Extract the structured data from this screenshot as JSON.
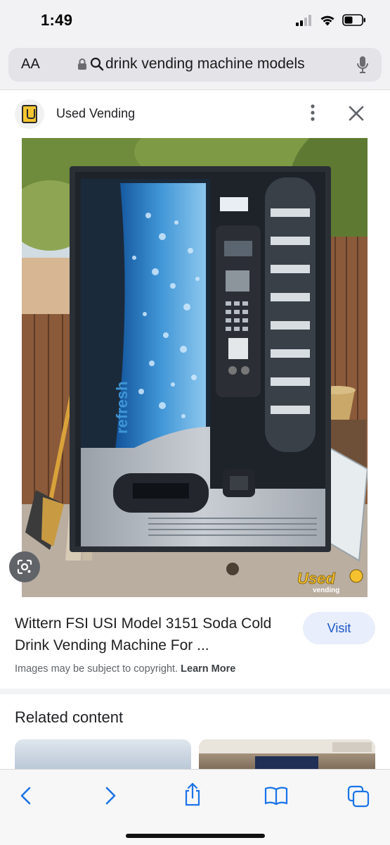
{
  "status": {
    "time": "1:49"
  },
  "browser": {
    "text_size_label": "AA",
    "url": "drink vending machine models"
  },
  "source": {
    "name": "Used Vending"
  },
  "image": {
    "machine_brand_text": "refresh",
    "watermark_text": "Used",
    "watermark_sub": "vending"
  },
  "result": {
    "title": "Wittern FSI USI Model 3151 Soda Cold Drink Vending Machine For ...",
    "visit_label": "Visit",
    "copyright_text": "Images may be subject to copyright.",
    "learn_more_label": "Learn More"
  },
  "related": {
    "heading": "Related content"
  },
  "colors": {
    "accent": "#1a56c7",
    "visit_bg": "#e8eefb",
    "toolbar_icon": "#1a73e8"
  },
  "icons": [
    "signal-icon",
    "wifi-icon",
    "battery-icon",
    "lock-icon",
    "search-icon",
    "microphone-icon",
    "more-vert-icon",
    "close-icon",
    "lens-icon",
    "back-icon",
    "forward-icon",
    "share-icon",
    "bookmarks-icon",
    "tabs-icon"
  ]
}
